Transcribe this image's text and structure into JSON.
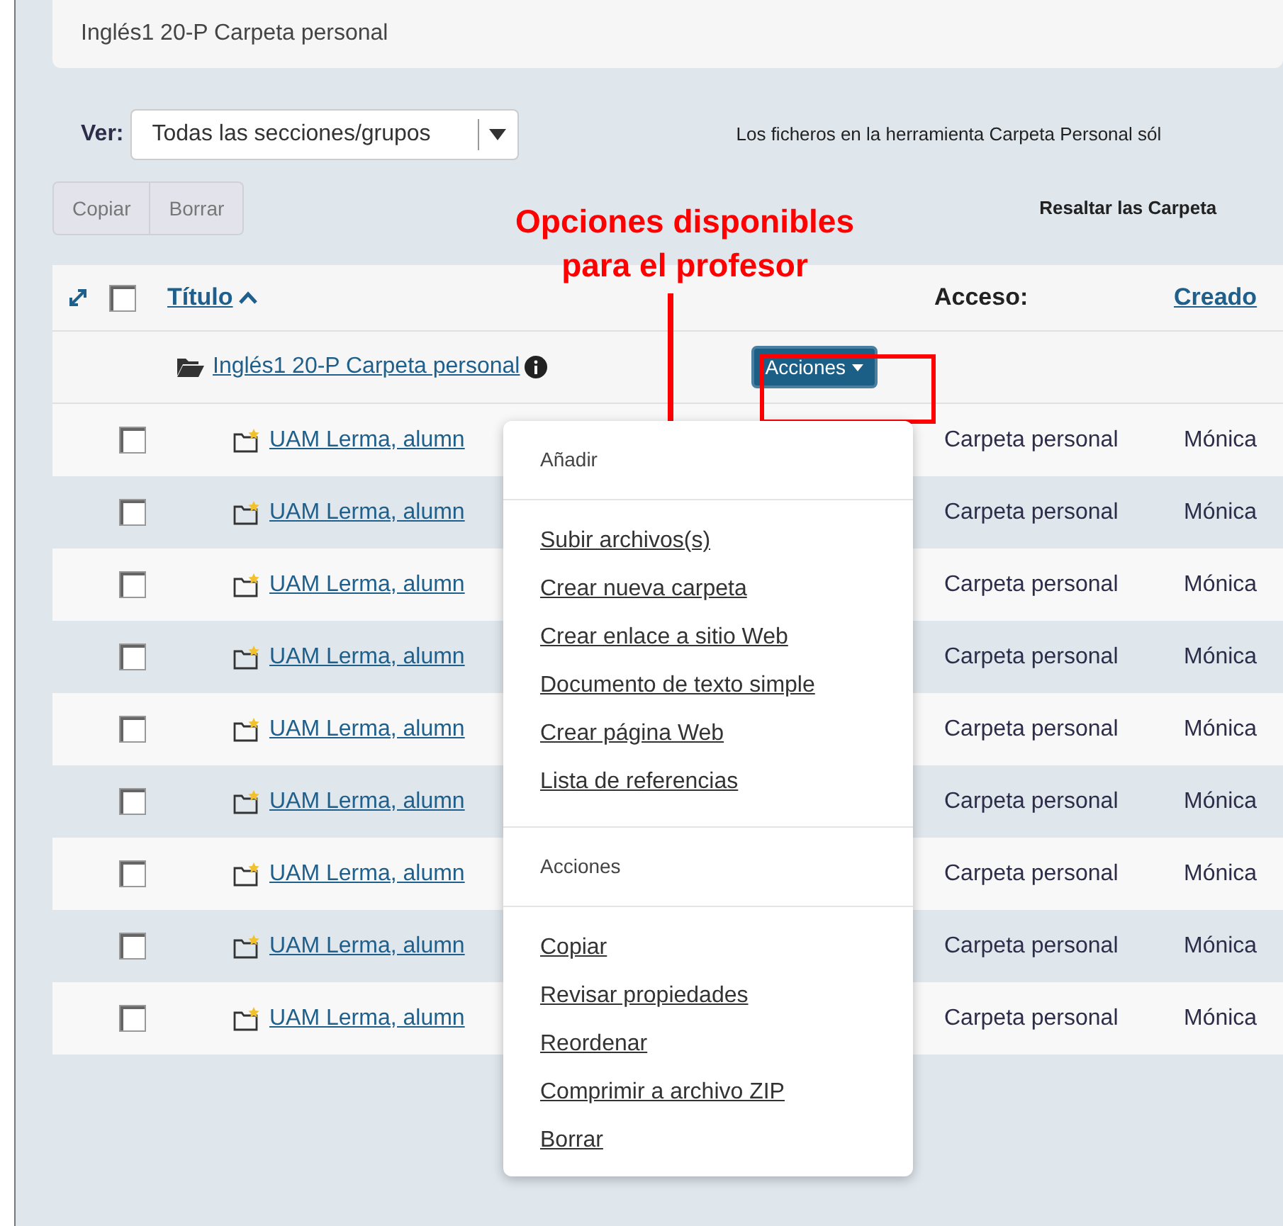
{
  "header": {
    "title": "Inglés1 20-P Carpeta personal"
  },
  "view": {
    "label": "Ver:",
    "value": "Todas las secciones/grupos"
  },
  "notice": "Los ficheros en la herramienta Carpeta Personal sól",
  "buttons": [
    {
      "label": "Copiar",
      "disabled": true
    },
    {
      "label": "Borrar",
      "disabled": true
    }
  ],
  "highlight_label": "Resaltar las Carpeta",
  "annotation": {
    "lines": [
      "Opciones disponibles",
      "para el profesor"
    ]
  },
  "table": {
    "select_all": {
      "checked": false
    },
    "columns": [
      {
        "label": "Título",
        "sorted": true,
        "link": true
      },
      {
        "label": "Acceso:",
        "sorted": false,
        "link": false
      },
      {
        "label": "Creado",
        "sorted": false,
        "link": true
      }
    ],
    "parent": {
      "title": "Inglés1 20-P Carpeta personal",
      "actions_label": "Acciones"
    },
    "rows": [
      {
        "checked": false,
        "title": "UAM Lerma, alumn",
        "access": "Carpeta personal",
        "creator": "Mónica"
      },
      {
        "checked": false,
        "title": "UAM Lerma, alumn",
        "access": "Carpeta personal",
        "creator": "Mónica"
      },
      {
        "checked": false,
        "title": "UAM Lerma, alumn",
        "access": "Carpeta personal",
        "creator": "Mónica"
      },
      {
        "checked": false,
        "title": "UAM Lerma, alumn",
        "access": "Carpeta personal",
        "creator": "Mónica"
      },
      {
        "checked": false,
        "title": "UAM Lerma, alumn",
        "access": "Carpeta personal",
        "creator": "Mónica"
      },
      {
        "checked": false,
        "title": "UAM Lerma, alumn",
        "access": "Carpeta personal",
        "creator": "Mónica"
      },
      {
        "checked": false,
        "title": "UAM Lerma, alumn",
        "access": "Carpeta personal",
        "creator": "Mónica"
      },
      {
        "checked": false,
        "title": "UAM Lerma, alumn",
        "access": "Carpeta personal",
        "creator": "Mónica"
      },
      {
        "checked": false,
        "title": "UAM Lerma, alumn",
        "access": "Carpeta personal",
        "creator": "Mónica"
      }
    ]
  },
  "actions_menu": {
    "sections": [
      {
        "header": "Añadir",
        "items": [
          "Subir archivos(s)",
          "Crear nueva carpeta",
          "Crear enlace a sitio Web",
          "Documento de texto simple",
          "Crear página Web",
          "Lista de referencias"
        ]
      },
      {
        "header": "Acciones",
        "items": [
          "Copiar",
          "Revisar propiedades",
          "Reordenar",
          "Comprimir a archivo ZIP",
          "Borrar"
        ]
      }
    ]
  }
}
